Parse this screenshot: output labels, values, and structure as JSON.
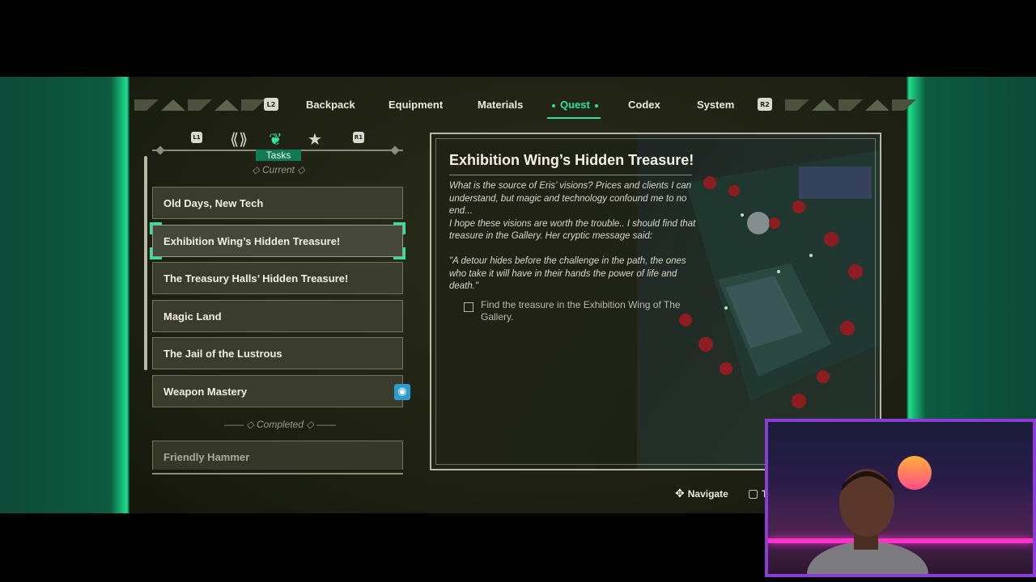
{
  "nav": {
    "left_button": "L2",
    "right_button": "R2",
    "tabs": [
      {
        "label": "Backpack",
        "active": false
      },
      {
        "label": "Equipment",
        "active": false
      },
      {
        "label": "Materials",
        "active": false
      },
      {
        "label": "Quest",
        "active": true
      },
      {
        "label": "Codex",
        "active": false
      },
      {
        "label": "System",
        "active": false
      }
    ]
  },
  "subtabs": {
    "left_button": "L1",
    "right_button": "R1",
    "icons": [
      "link-icon",
      "tasks-icon",
      "star-icon"
    ],
    "active_label": "Tasks"
  },
  "sections": {
    "current": "Current",
    "completed": "Completed"
  },
  "quests_current": [
    {
      "title": "Old Days, New Tech"
    },
    {
      "title": "Exhibition Wing’s Hidden Treasure!",
      "selected": true
    },
    {
      "title": "The Treasury Halls’ Hidden Treasure!"
    },
    {
      "title": "Magic Land"
    },
    {
      "title": "The Jail of the Lustrous"
    },
    {
      "title": "Weapon Mastery",
      "tracked": true
    }
  ],
  "quests_completed": [
    {
      "title": "Friendly Hammer"
    }
  ],
  "detail": {
    "title": "Exhibition Wing’s Hidden Treasure!",
    "description": "What is the source of Eris’ visions? Prices and clients I can understand, but magic and technology confound me to no end...\nI hope these visions are worth the trouble.. I should find that treasure in the Gallery. Her cryptic message said:\n\n\"A detour hides before the challenge in the path, the ones who take it will have in their hands the power of life and death.\"",
    "objective": "Find the treasure in the Exhibition Wing of The Gallery."
  },
  "prompts": {
    "navigate": "Navigate",
    "track_partial": "Tra"
  },
  "colors": {
    "accent": "#2ee3a0",
    "panel": "#3a3d2c",
    "webcam_border": "#8b3bd6"
  }
}
